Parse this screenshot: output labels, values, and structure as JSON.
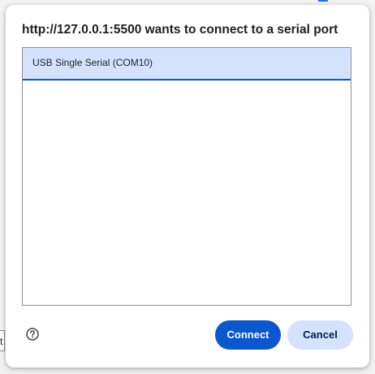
{
  "dialog": {
    "title": "http://127.0.0.1:5500 wants to connect to a serial port",
    "devices": [
      {
        "label": "USB Single Serial (COM10)",
        "selected": true
      }
    ],
    "help_icon": "help-circle-icon",
    "connect_label": "Connect",
    "cancel_label": "Cancel"
  },
  "background": {
    "tab_text": "t"
  },
  "colors": {
    "primary": "#0b57d0",
    "selected_bg": "#d3e3fd",
    "cancel_text": "#041e49"
  }
}
